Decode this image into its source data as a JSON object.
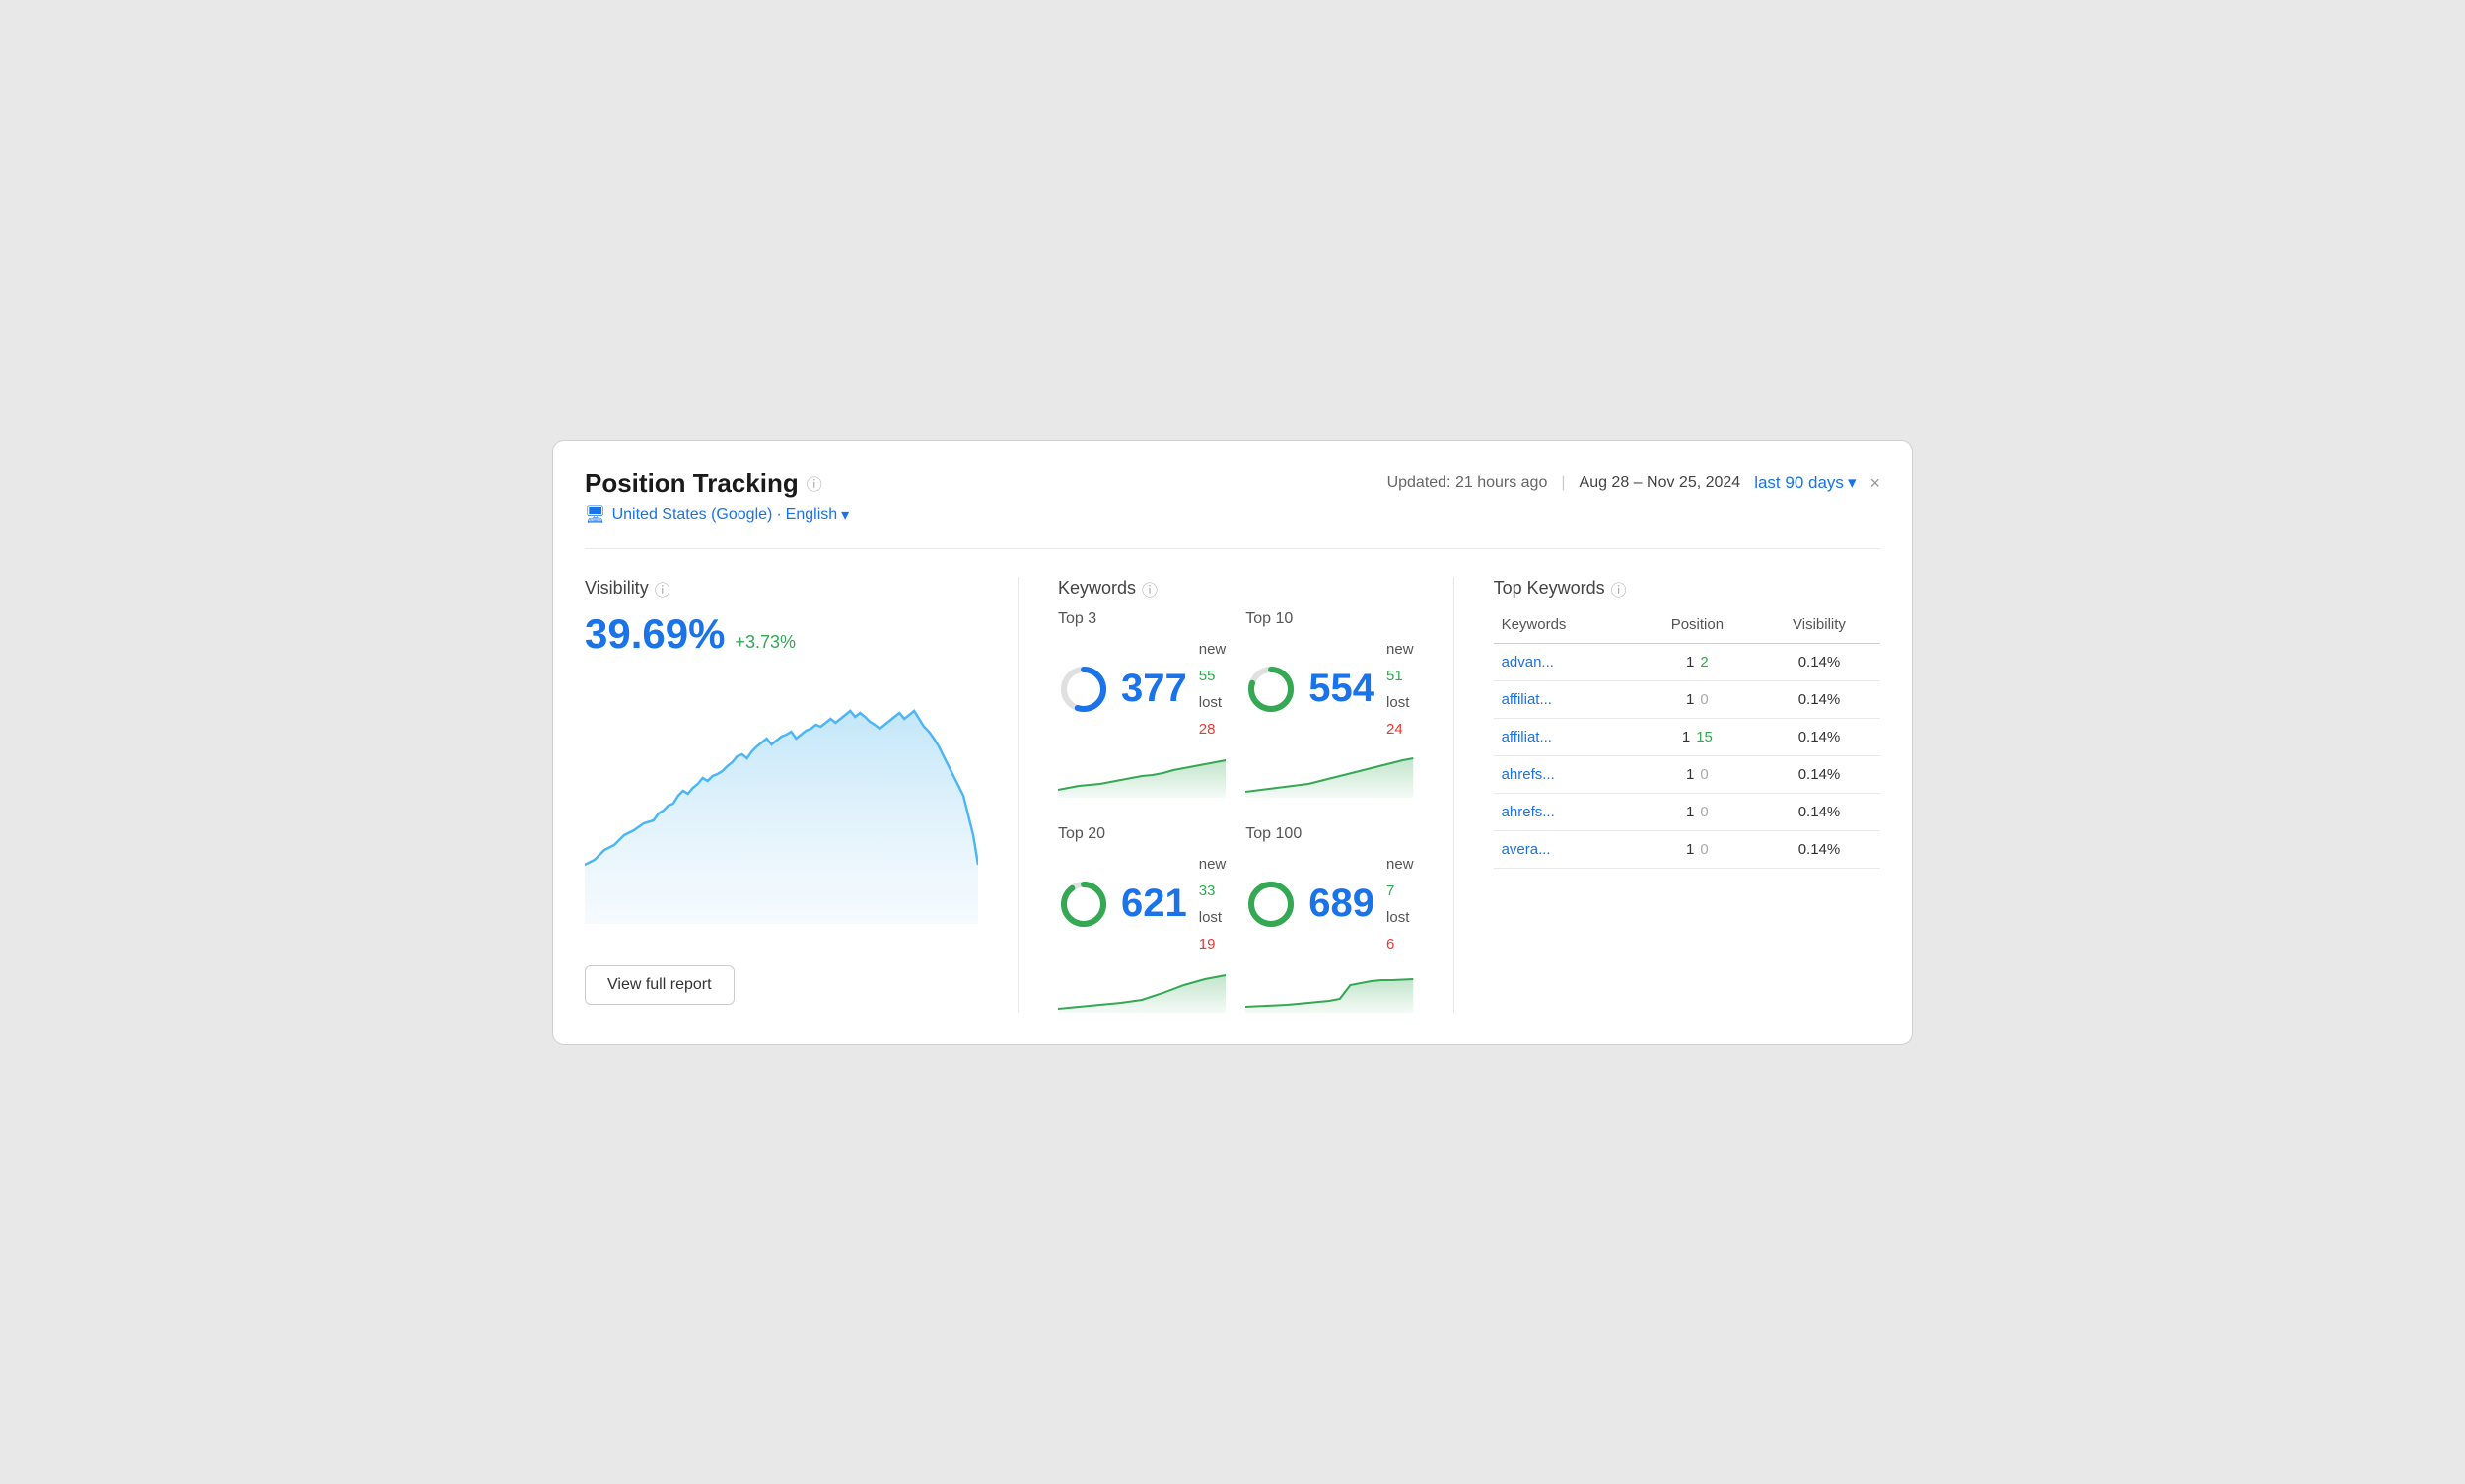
{
  "header": {
    "title": "Position Tracking",
    "updated": "Updated: 21 hours ago",
    "date_range": "Aug 28 – Nov 25, 2024",
    "period": "last 90 days",
    "close_label": "×"
  },
  "sub_header": {
    "location": "United States (Google)",
    "language": "English"
  },
  "visibility": {
    "label": "Visibility",
    "value": "39.69%",
    "change": "+3.73%"
  },
  "keywords": {
    "label": "Keywords",
    "blocks": [
      {
        "title": "Top 3",
        "value": "377",
        "new": "55",
        "lost": "28",
        "donut_pct": 55
      },
      {
        "title": "Top 10",
        "value": "554",
        "new": "51",
        "lost": "24",
        "donut_pct": 80
      },
      {
        "title": "Top 20",
        "value": "621",
        "new": "33",
        "lost": "19",
        "donut_pct": 90
      },
      {
        "title": "Top 100",
        "value": "689",
        "new": "7",
        "lost": "6",
        "donut_pct": 99
      }
    ]
  },
  "top_keywords": {
    "label": "Top Keywords",
    "columns": [
      "Keywords",
      "Position",
      "Visibility"
    ],
    "rows": [
      {
        "keyword": "advan...",
        "pos": "1",
        "pos_change": "2",
        "pos_change_type": "positive",
        "visibility": "0.14%"
      },
      {
        "keyword": "affiliat...",
        "pos": "1",
        "pos_change": "0",
        "pos_change_type": "zero",
        "visibility": "0.14%"
      },
      {
        "keyword": "affiliat...",
        "pos": "1",
        "pos_change": "15",
        "pos_change_type": "positive",
        "visibility": "0.14%"
      },
      {
        "keyword": "ahrefs...",
        "pos": "1",
        "pos_change": "0",
        "pos_change_type": "zero",
        "visibility": "0.14%"
      },
      {
        "keyword": "ahrefs...",
        "pos": "1",
        "pos_change": "0",
        "pos_change_type": "zero",
        "visibility": "0.14%"
      },
      {
        "keyword": "avera...",
        "pos": "1",
        "pos_change": "0",
        "pos_change_type": "zero",
        "visibility": "0.14%"
      }
    ]
  },
  "buttons": {
    "view_full_report": "View full report"
  },
  "colors": {
    "blue": "#1a73e8",
    "green": "#34a853",
    "red": "#e53935",
    "light_blue_chart": "#b3e0f7",
    "blue_line": "#4db6f7"
  }
}
